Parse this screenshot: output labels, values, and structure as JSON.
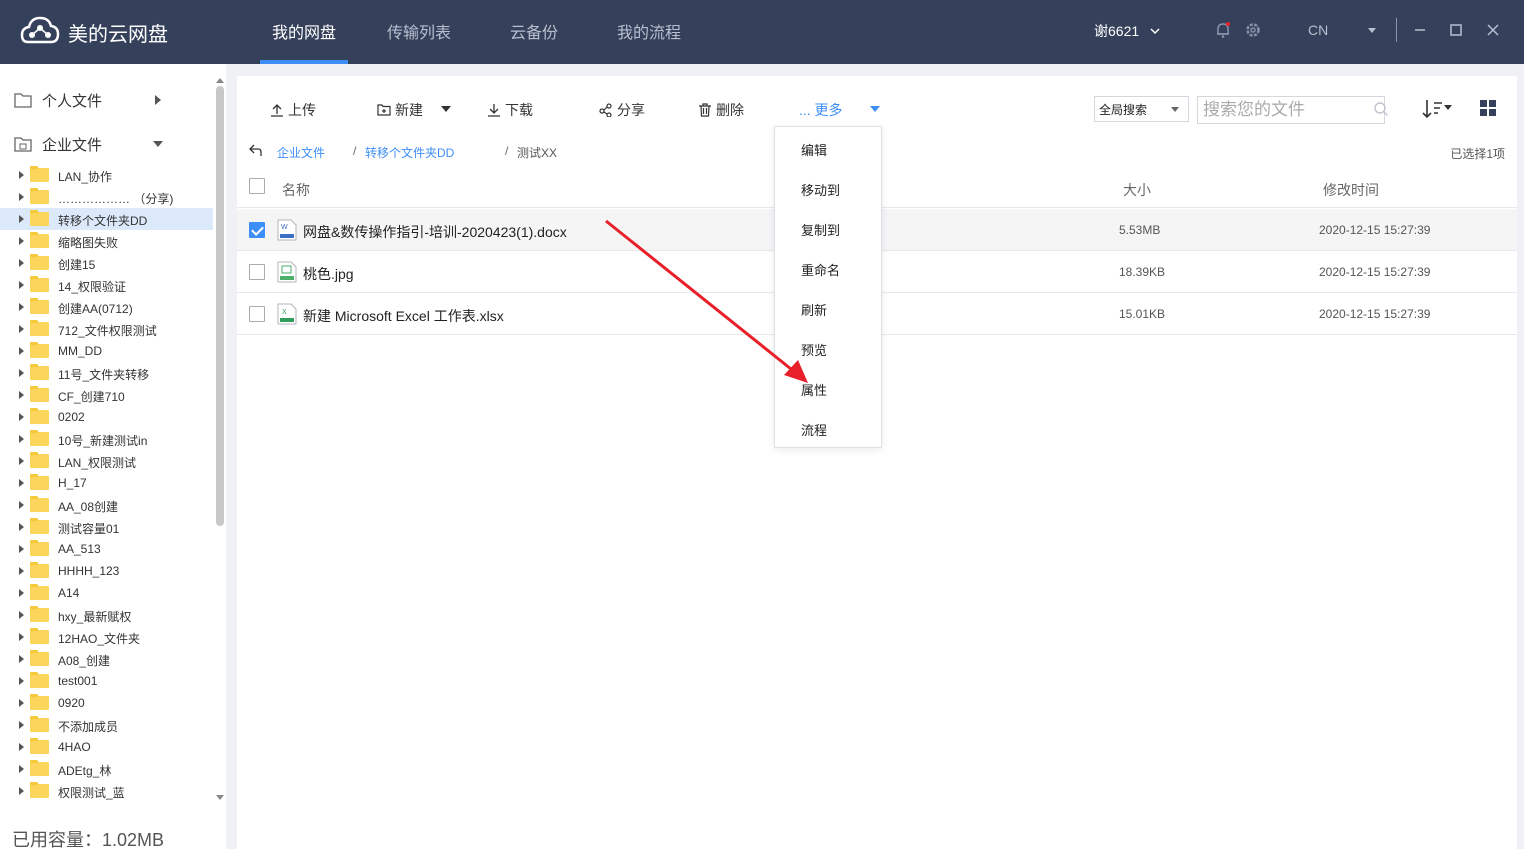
{
  "app": {
    "name": "美的云网盘"
  },
  "nav": {
    "tabs": [
      "我的网盘",
      "传输列表",
      "云备份",
      "我的流程"
    ]
  },
  "user": {
    "name": "谢6621"
  },
  "lang": "CN",
  "sidebar": {
    "personal": "个人文件",
    "enterprise": "企业文件",
    "folders": [
      "LAN_协作",
      "……………… （分享)",
      "转移个文件夹DD",
      "缩略图失败",
      "创建15",
      "14_权限验证",
      "创建AA(0712)",
      "712_文件权限测试",
      "MM_DD",
      "11号_文件夹转移",
      "CF_创建710",
      "0202",
      "10号_新建测试in",
      "LAN_权限测试",
      "H_17",
      "AA_08创建",
      "测试容量01",
      "AA_513",
      "HHHH_123",
      "A14",
      "hxy_最新赋权",
      "12HAO_文件夹",
      "A08_创建",
      "test001",
      "0920",
      "不添加成员",
      "4HAO",
      "ADEtg_林",
      "权限测试_蓝"
    ],
    "selected_index": 2,
    "capacity": "已用容量：1.02MB"
  },
  "toolbar": {
    "upload": "上传",
    "new": "新建",
    "download": "下载",
    "share": "分享",
    "delete": "删除",
    "more": "... 更多",
    "search_scope": "全局搜索",
    "search_placeholder": "搜索您的文件"
  },
  "breadcrumb": {
    "root": "企业文件",
    "sep1": "/",
    "folder": "转移个文件夹DD",
    "sep2": "/",
    "current": "测试XX"
  },
  "selected_count": "已选择1项",
  "table": {
    "headers": {
      "name": "名称",
      "size": "大小",
      "modified": "修改时间"
    },
    "rows": [
      {
        "name": "网盘&数传操作指引-培训-2020423(1).docx",
        "size": "5.53MB",
        "modified": "2020-12-15 15:27:39",
        "type": "word",
        "checked": true
      },
      {
        "name": "桃色.jpg",
        "size": "18.39KB",
        "modified": "2020-12-15 15:27:39",
        "type": "image",
        "checked": false
      },
      {
        "name": "新建 Microsoft Excel 工作表.xlsx",
        "size": "15.01KB",
        "modified": "2020-12-15 15:27:39",
        "type": "excel",
        "checked": false
      }
    ]
  },
  "more_menu": [
    "编辑",
    "移动到",
    "复制到",
    "重命名",
    "刷新",
    "预览",
    "属性",
    "流程"
  ],
  "colors": {
    "topbar": "#35405a",
    "accent": "#3e8ef7",
    "annotation": "#e8202a"
  },
  "icons": [
    "cloud-logo-icon",
    "bell-icon",
    "gear-icon",
    "folder-icon",
    "enterprise-icon",
    "upload-icon",
    "new-folder-icon",
    "download-icon",
    "share-icon",
    "trash-icon",
    "search-icon",
    "sort-icon",
    "grid-view-icon",
    "back-icon"
  ]
}
